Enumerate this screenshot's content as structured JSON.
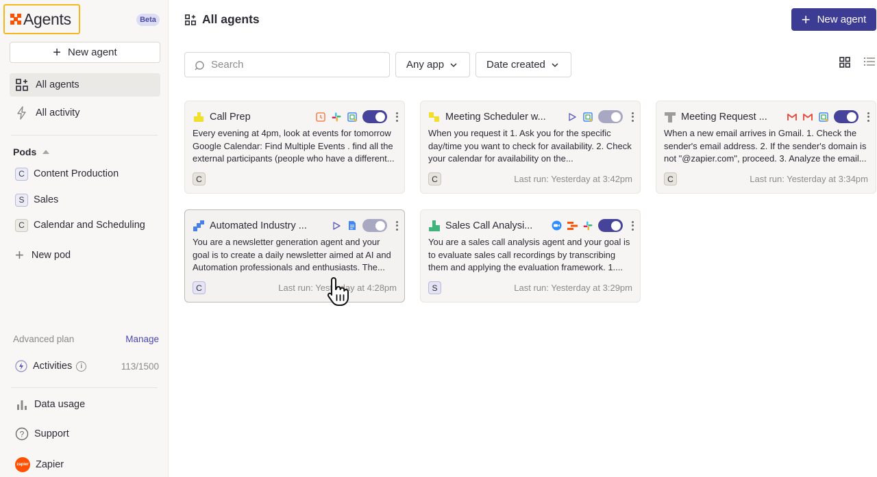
{
  "sidebar": {
    "brand": "Agents",
    "beta": "Beta",
    "new_agent": "New agent",
    "nav": [
      {
        "label": "All agents",
        "icon": "grid-plus-icon",
        "active": true
      },
      {
        "label": "All activity",
        "icon": "bolt-icon",
        "active": false
      }
    ],
    "pods_title": "Pods",
    "pods": [
      {
        "badge": "C",
        "label": "Content Production"
      },
      {
        "badge": "S",
        "label": "Sales"
      },
      {
        "badge": "C",
        "label": "Calendar and Scheduling"
      }
    ],
    "new_pod": "New pod",
    "plan_label": "Advanced plan",
    "manage": "Manage",
    "activities_label": "Activities",
    "activities_count": "113/1500",
    "data_usage": "Data usage",
    "support": "Support",
    "account": "Zapier",
    "account_avatar": "zapier"
  },
  "main": {
    "title": "All agents",
    "new_agent": "New agent",
    "search_placeholder": "Search",
    "filters": {
      "app": "Any app",
      "date": "Date created"
    },
    "cards": [
      {
        "name": "Call Prep",
        "description": "Every evening at 4pm, look at events for tomorrow Google Calendar: Find Multiple Events . find all the external participants (people who have a different...",
        "pod": "C",
        "last_run": "",
        "enabled": true,
        "apps": [
          "schedule-icon",
          "slack-icon",
          "google-calendar-icon"
        ]
      },
      {
        "name": "Meeting Scheduler w...",
        "description": "When you request it 1. Ask you for the specific day/time you want to check for availability. 2. Check your calendar for availability on the...",
        "pod": "C",
        "last_run": "Last run: Yesterday at 3:42pm",
        "enabled": false,
        "apps": [
          "play-icon",
          "google-calendar-icon"
        ]
      },
      {
        "name": "Meeting Request ...",
        "description": "When a new email arrives in Gmail. 1. Check the sender's email address. 2. If the sender's domain is not \"@zapier.com\", proceed. 3. Analyze the email...",
        "pod": "C",
        "last_run": "Last run: Yesterday at 3:34pm",
        "enabled": true,
        "apps": [
          "gmail-icon",
          "gmail-icon",
          "google-calendar-icon"
        ]
      },
      {
        "name": "Automated Industry ...",
        "description": "You are a newsletter generation agent and your goal is to create a daily newsletter aimed at AI and Automation professionals and enthusiasts. The...",
        "pod": "C",
        "last_run": "Last run: Yesterday at 4:28pm",
        "enabled": false,
        "apps": [
          "play-icon",
          "google-docs-icon"
        ]
      },
      {
        "name": "Sales Call Analysi...",
        "description": "You are a sales call analysis agent and your goal is to evaluate sales call recordings by transcribing them and applying the evaluation framework. 1....",
        "pod": "S",
        "last_run": "Last run: Yesterday at 3:29pm",
        "enabled": true,
        "apps": [
          "zoom-icon",
          "zapier-tables-icon",
          "slack-icon"
        ]
      }
    ]
  }
}
